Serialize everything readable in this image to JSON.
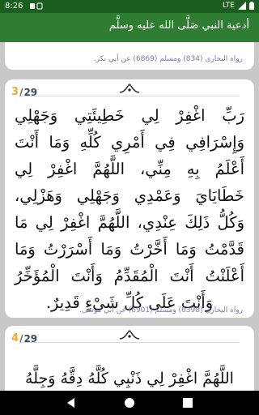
{
  "status": {
    "time": "8:26",
    "network": "LTE",
    "icons": [
      "notification-icon",
      "wifi-icon",
      "signal-icon",
      "battery-icon"
    ]
  },
  "app": {
    "title": "أدعية النبي صَلَّى الله عليه وسلَّم"
  },
  "cards": {
    "prev": {
      "source": "رواه البخاري (834) ومسلم (6869) عن أبي بكر."
    },
    "main": {
      "current": "3",
      "separator": "/",
      "total": "29",
      "text": "رَبِّ اغْفِرْ لِي خَطِيئَتِي وَجَهْلِي وَإِسْرَافِي فِي أَمْرِي كُلِّهِ وَمَا أَنْتَ أَعْلَمُ بِهِ مِنِّي، اللَّهُمَّ اغْفِرْ لِي خَطَايَايَ وَعَمْدِي وَجَهْلِي وَهَزْلِي، وَكُلُّ ذَلِكَ عِنْدِي، اللَّهُمَّ اغْفِرْ لِي مَا قَدَّمْتُ وَمَا أَخَّرْتُ وَمَا أَسْرَرْتُ وَمَا أَعْلَنْتُ أَنْتَ الْمُقَدِّمُ وَأَنْتَ الْمُؤَخِّرُ وَأَنْتَ عَلَى كُلِّ شَيْءٍ قَدِيرٌ.",
      "source": "رواه البخاري (6398) ومسلم (6901) عن أبي موسى."
    },
    "next": {
      "current": "4",
      "separator": "/",
      "total": "29",
      "text": "اللَّهُمَّ اغْفِرْ لِي ذَنْبِي كُلَّهُ دِقَّهُ وَجِلَّهُ"
    }
  },
  "colors": {
    "status_bar": "#1b5e20",
    "app_bar": "#2e7d32",
    "background": "#c8c8c8",
    "counter_current": "#f9a825",
    "source_text": "#7b7bb0"
  }
}
